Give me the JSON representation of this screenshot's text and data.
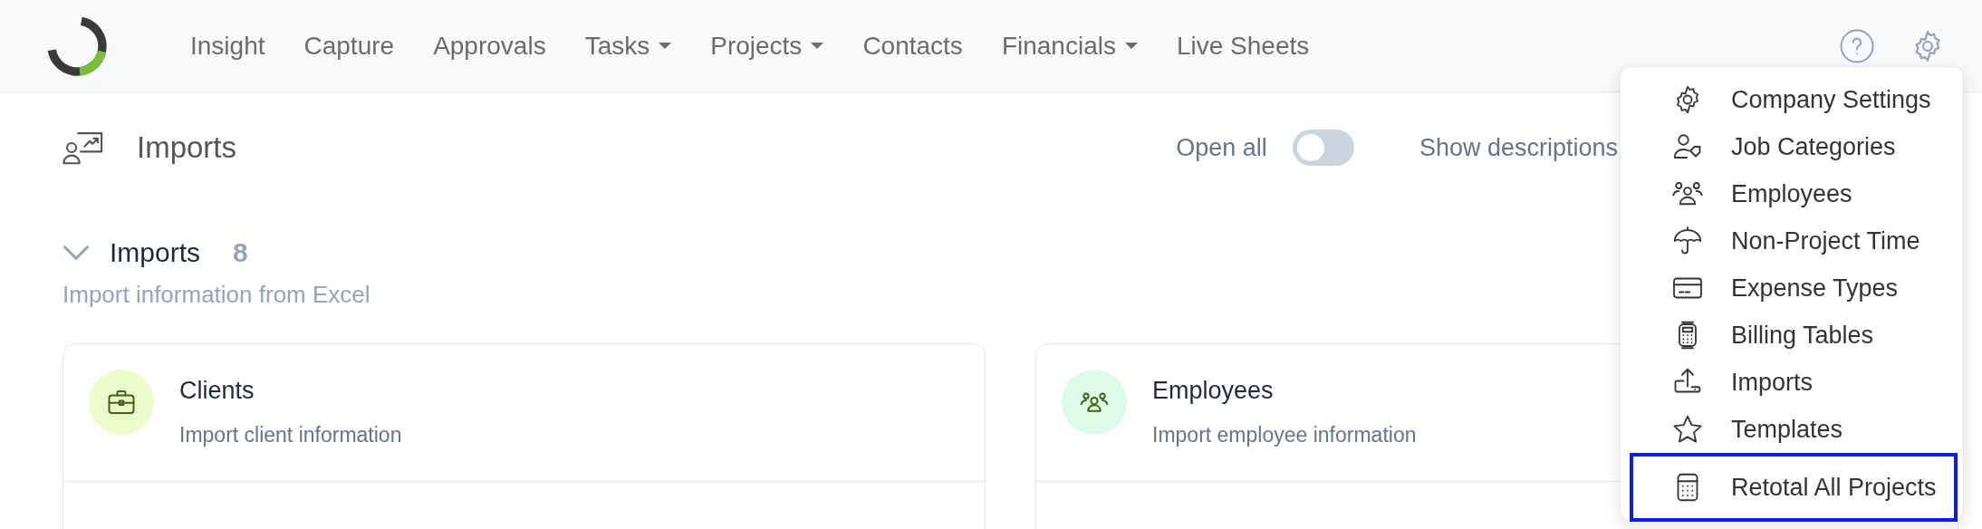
{
  "nav": {
    "items": [
      {
        "label": "Insight",
        "dropdown": false
      },
      {
        "label": "Capture",
        "dropdown": false
      },
      {
        "label": "Approvals",
        "dropdown": false
      },
      {
        "label": "Tasks",
        "dropdown": true
      },
      {
        "label": "Projects",
        "dropdown": true
      },
      {
        "label": "Contacts",
        "dropdown": false
      },
      {
        "label": "Financials",
        "dropdown": true
      },
      {
        "label": "Live Sheets",
        "dropdown": false
      }
    ]
  },
  "page": {
    "title": "Imports",
    "open_all": {
      "label": "Open all",
      "on": false
    },
    "show_descriptions": {
      "label": "Show descriptions"
    }
  },
  "section": {
    "title": "Imports",
    "count": "8",
    "expanded": true,
    "subtitle": "Import information from Excel",
    "cards": [
      {
        "title": "Clients",
        "description": "Import client information",
        "color": "#ecfccb"
      },
      {
        "title": "Employees",
        "description": "Import employee information",
        "color": "#dcfce7"
      }
    ]
  },
  "settings_menu": {
    "items": [
      {
        "label": "Company Settings",
        "highlighted": false
      },
      {
        "label": "Job Categories",
        "highlighted": false
      },
      {
        "label": "Employees",
        "highlighted": false
      },
      {
        "label": "Non-Project Time",
        "highlighted": false
      },
      {
        "label": "Expense Types",
        "highlighted": false
      },
      {
        "label": "Billing Tables",
        "highlighted": false
      },
      {
        "label": "Imports",
        "highlighted": false
      },
      {
        "label": "Templates",
        "highlighted": false
      },
      {
        "label": "Retotal All Projects",
        "highlighted": true
      }
    ]
  }
}
